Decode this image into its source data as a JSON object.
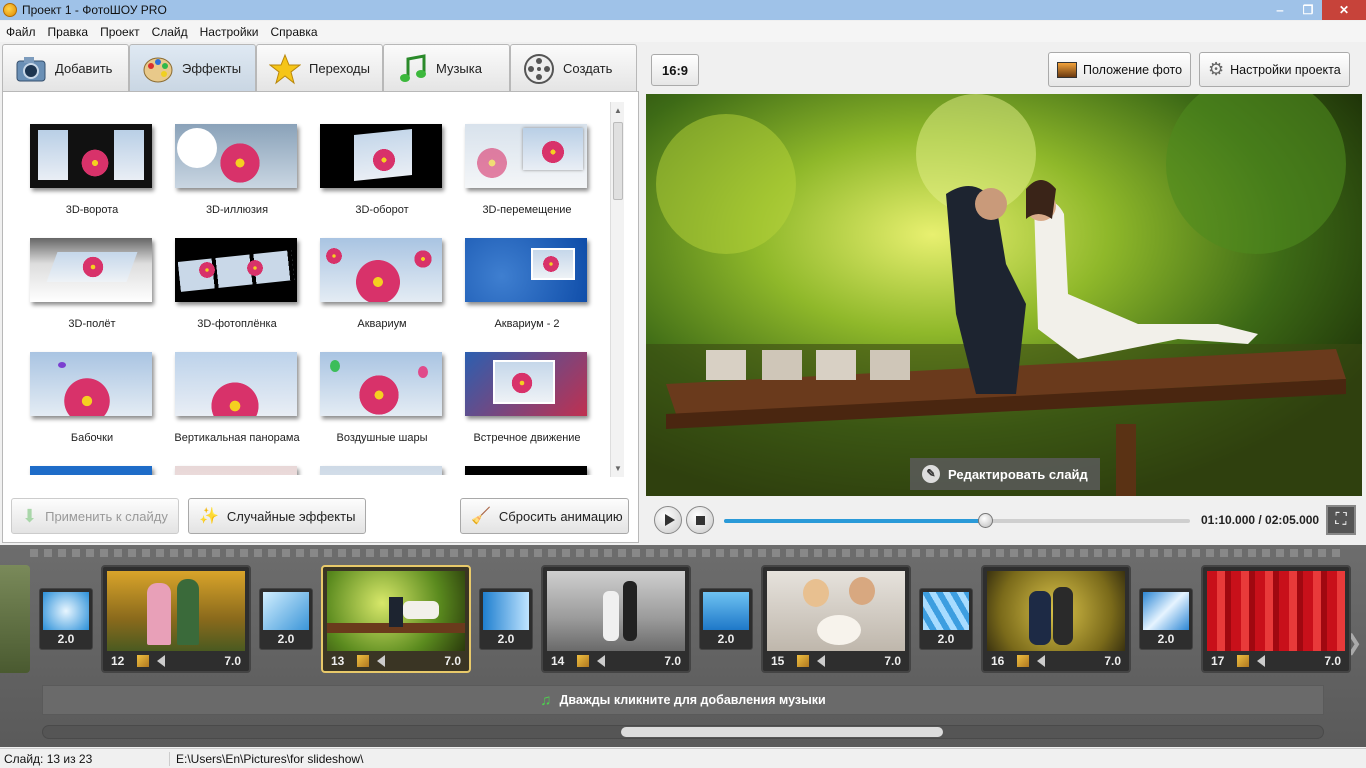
{
  "window": {
    "title": "Проект 1 - ФотоШОУ PRO"
  },
  "menu": [
    "Файл",
    "Правка",
    "Проект",
    "Слайд",
    "Настройки",
    "Справка"
  ],
  "tabs": [
    {
      "label": "Добавить",
      "icon": "camera-icon"
    },
    {
      "label": "Эффекты",
      "icon": "palette-icon",
      "active": true
    },
    {
      "label": "Переходы",
      "icon": "star-icon"
    },
    {
      "label": "Музыка",
      "icon": "music-note-icon"
    },
    {
      "label": "Создать",
      "icon": "film-reel-icon"
    }
  ],
  "effects": [
    "3D-ворота",
    "3D-иллюзия",
    "3D-оборот",
    "3D-перемещение",
    "3D-полёт",
    "3D-фотоплёнка",
    "Аквариум",
    "Аквариум - 2",
    "Бабочки",
    "Вертикальная панорама",
    "Воздушные шары",
    "Встречное движение"
  ],
  "effect_buttons": {
    "apply": "Применить к слайду",
    "random": "Случайные эффекты",
    "reset": "Сбросить анимацию"
  },
  "preview": {
    "ratio": "16:9",
    "photo_position": "Положение фото",
    "project_settings": "Настройки проекта",
    "edit_slide": "Редактировать слайд",
    "timecode": "01:10.000 / 02:05.000",
    "progress": 0.56
  },
  "timeline": {
    "transitions": [
      "2.0",
      "2.0",
      "2.0",
      "2.0",
      "2.0",
      "2.0"
    ],
    "slides": [
      {
        "num": "12",
        "dur": "7.0"
      },
      {
        "num": "13",
        "dur": "7.0",
        "selected": true
      },
      {
        "num": "14",
        "dur": "7.0"
      },
      {
        "num": "15",
        "dur": "7.0"
      },
      {
        "num": "16",
        "dur": "7.0"
      },
      {
        "num": "17",
        "dur": "7.0"
      }
    ],
    "music_hint": "Дважды кликните для добавления музыки"
  },
  "status": {
    "slide": "Слайд: 13 из 23",
    "path": "E:\\Users\\En\\Pictures\\for slideshow\\"
  },
  "colors": {
    "accent": "#2a9ad8",
    "selected_border": "#e8c96a",
    "titlebar": "#9fc2e8"
  }
}
